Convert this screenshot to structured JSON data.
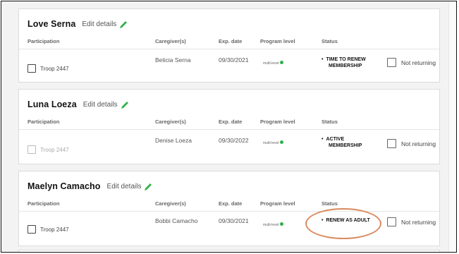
{
  "headers": {
    "participation": "Participation",
    "caregivers": "Caregiver(s)",
    "exp_date": "Exp. date",
    "program_level": "Program level",
    "status": "Status"
  },
  "cards": [
    {
      "name": "Love Serna",
      "edit_label": "Edit details",
      "troop": "Troop 2447",
      "caregiver": "Beticia Serna",
      "exp_date": "09/30/2021",
      "program_level": "multi-level",
      "status_line1": "TIME TO RENEW",
      "status_line2": "MEMBERSHIP",
      "not_returning": "Not returning"
    },
    {
      "name": "Luna Loeza",
      "edit_label": "Edit details",
      "troop": "Troop 2447",
      "caregiver": "Denise Loeza",
      "exp_date": "09/30/2022",
      "program_level": "multi-level",
      "status_line1": "ACTIVE",
      "status_line2": "MEMBERSHIP",
      "not_returning": "Not returning"
    },
    {
      "name": "Maelyn Camacho",
      "edit_label": "Edit details",
      "troop": "Troop 2447",
      "caregiver": "Bobbi Camacho",
      "exp_date": "09/30/2021",
      "program_level": "multi-level",
      "status_line1": "RENEW AS ADULT",
      "status_line2": "",
      "not_returning": "Not returning"
    }
  ],
  "colors": {
    "accent_green": "#2fb24a",
    "highlight": "#d98a5e"
  }
}
